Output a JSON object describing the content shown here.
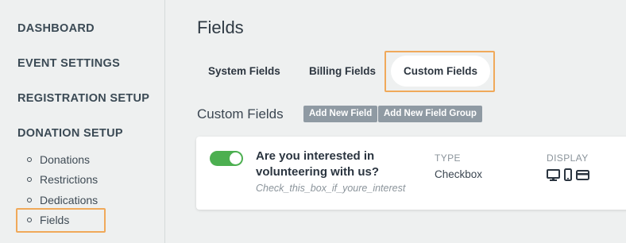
{
  "sidebar": {
    "sections": [
      {
        "label": "DASHBOARD"
      },
      {
        "label": "EVENT SETTINGS"
      },
      {
        "label": "REGISTRATION SETUP"
      },
      {
        "label": "DONATION SETUP"
      }
    ],
    "sub_items": [
      {
        "label": "Donations"
      },
      {
        "label": "Restrictions"
      },
      {
        "label": "Dedications"
      },
      {
        "label": "Fields"
      }
    ],
    "highlighted_item": "Fields"
  },
  "main": {
    "title": "Fields",
    "tabs": [
      {
        "label": "System Fields",
        "active": false
      },
      {
        "label": "Billing Fields",
        "active": false
      },
      {
        "label": "Custom Fields",
        "active": true
      }
    ],
    "section_title": "Custom Fields",
    "buttons": {
      "add_field": "Add New Field",
      "add_group": "Add New Field Group"
    },
    "fields": [
      {
        "enabled": true,
        "question": "Are you interested in volunteering with us?",
        "key": "Check_this_box_if_youre_interest",
        "type_label": "TYPE",
        "type_value": "Checkbox",
        "display_label": "DISPLAY",
        "display_icons": [
          "desktop-icon",
          "mobile-icon",
          "card-icon"
        ]
      }
    ]
  },
  "colors": {
    "background": "#eef0f0",
    "highlight": "#f0a95a",
    "toggle_on": "#4caf50",
    "button_gray": "#8f9aa3"
  }
}
